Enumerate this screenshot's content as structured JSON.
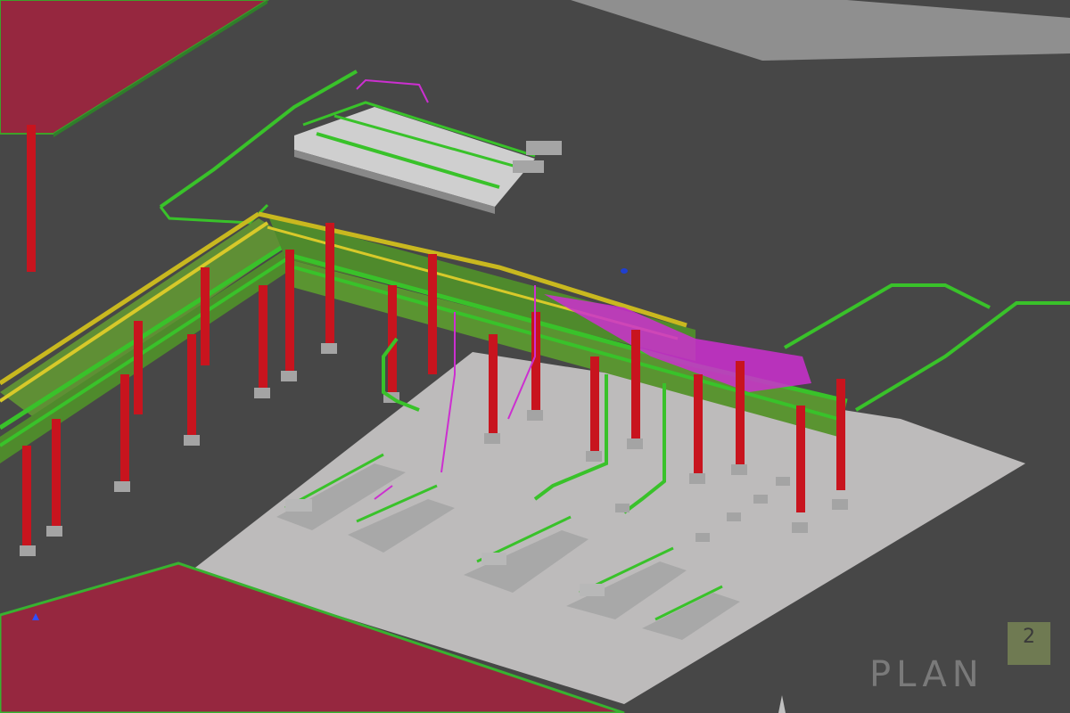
{
  "scene": {
    "kind": "3D plant piping model",
    "colors": {
      "background": "#474747",
      "ground_pad": "#bdbbbb",
      "building_fill": "#96273f",
      "pipe_green": "#39c22a",
      "pipe_yellow": "#c9b81f",
      "pipe_magenta": "#cc2fd0",
      "steel_green": "#4f8a2c",
      "column_red": "#c8141e",
      "equipment_grey": "#9a9a9a"
    }
  },
  "logo": {
    "word": "PLAN",
    "superscript": "2",
    "square_color": "#6f7a52"
  }
}
